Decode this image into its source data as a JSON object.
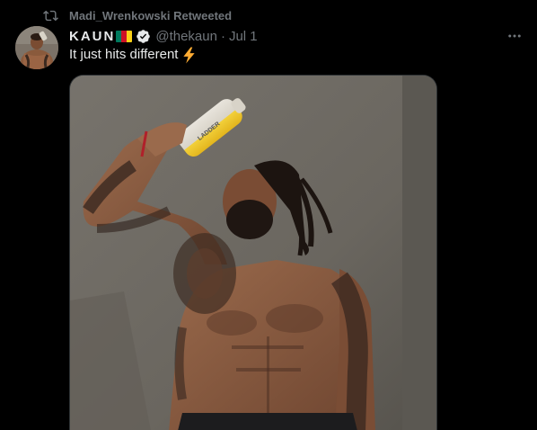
{
  "retweet": {
    "label": "Madi_Wrenkowski Retweeted",
    "icon": "retweet-icon"
  },
  "author": {
    "display_name": "KAUN",
    "flag": "cameroon-flag",
    "flag_colors": [
      "#007a5e",
      "#ce1126",
      "#fcd116"
    ],
    "verified": true,
    "handle": "@thekaun",
    "separator": "·",
    "date": "Jul 1",
    "avatar": "avatar"
  },
  "tweet": {
    "text": "It just hits different",
    "emoji": "lightning-bolt-icon"
  },
  "menu": {
    "icon": "more-horizontal-icon"
  },
  "media": {
    "alt": "photo",
    "bottle_label": "LADDER"
  },
  "colors": {
    "background": "#000000",
    "text": "#e7e9ea",
    "secondary": "#71767b",
    "bolt": "#ffac33"
  }
}
